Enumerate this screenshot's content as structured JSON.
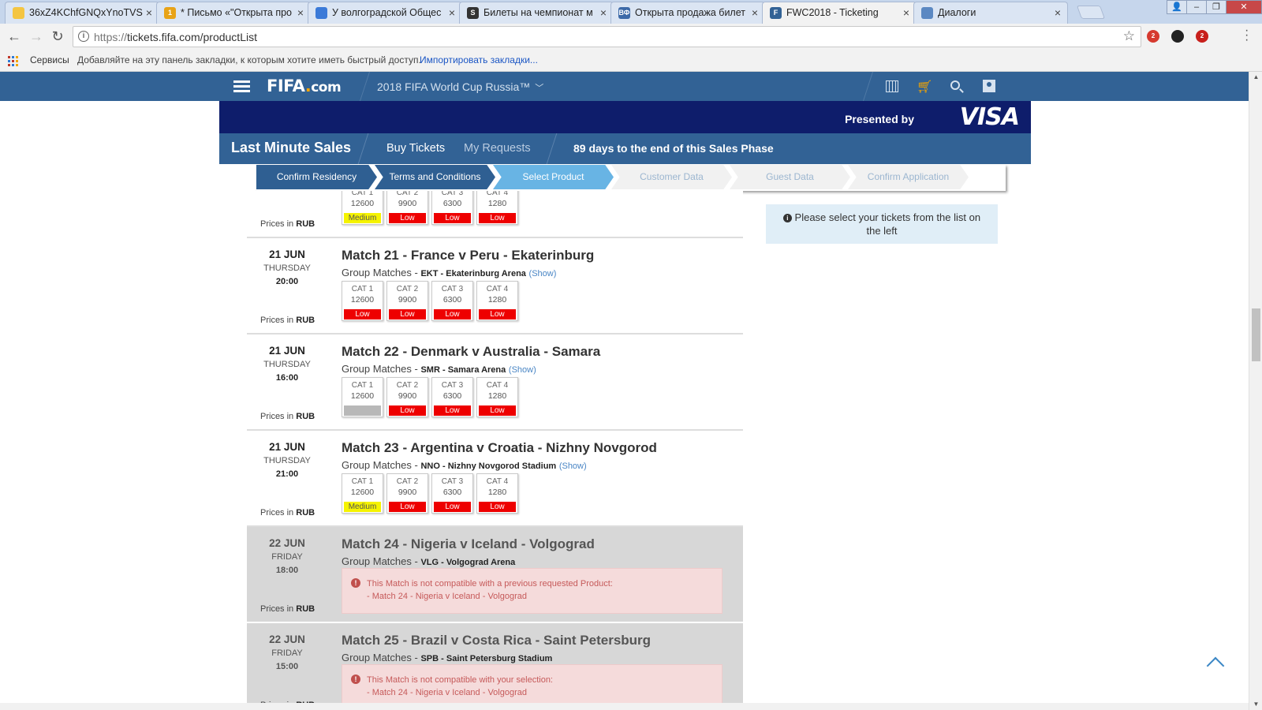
{
  "browser": {
    "tabs": [
      {
        "title": "36xZ4KChfGNQxYnoTVS",
        "favicon_color": "#f4c542",
        "favicon_glyph": "",
        "active": false
      },
      {
        "title": "* Письмо «\"Открыта про",
        "favicon_color": "#e8a317",
        "favicon_glyph": "1",
        "active": false
      },
      {
        "title": "У волгоградской Общес",
        "favicon_color": "#3b7ad8",
        "favicon_glyph": "",
        "active": false
      },
      {
        "title": "Билеты на чемпионат м",
        "favicon_color": "#333333",
        "favicon_glyph": "S",
        "active": false
      },
      {
        "title": "Открыта продажа билет",
        "favicon_color": "#3d6aa8",
        "favicon_glyph": "ВФ",
        "active": false
      },
      {
        "title": "FWC2018 - Ticketing",
        "favicon_color": "#326295",
        "favicon_glyph": "F",
        "active": true
      },
      {
        "title": "Диалоги",
        "favicon_color": "#5b88c2",
        "favicon_glyph": "",
        "active": false
      }
    ],
    "tab_close_glyph": "×",
    "url_prefix": "https://",
    "url_main": "tickets.fifa.com/productList",
    "bookmarks": {
      "services": "Сервисы",
      "hint": "Добавляйте на эту панель закладки, к которым хотите иметь быстрый доступ.",
      "import_link": "Импортировать закладки..."
    },
    "extensions": [
      {
        "name": "opera-ext-icon",
        "color": "#d63a2f",
        "badge": "2"
      },
      {
        "name": "flash-ext-icon",
        "color": "#222222",
        "badge": ""
      },
      {
        "name": "adblock-ext-icon",
        "color": "#c8201c",
        "badge": "2"
      }
    ]
  },
  "site": {
    "logo_text": "FIFA",
    "logo_dot": ".",
    "logo_com": "com",
    "event": "2018 FIFA World Cup Russia™",
    "presented_by": "Presented by",
    "sponsor": "VISA",
    "section_title": "Last Minute Sales",
    "nav_buy": "Buy Tickets",
    "nav_requests": "My Requests",
    "days_left": "89 days to the end of this Sales Phase"
  },
  "steps": [
    {
      "label": "Confirm Residency",
      "state": "done"
    },
    {
      "label": "Terms and Conditions",
      "state": "done"
    },
    {
      "label": "Select Product",
      "state": "current"
    },
    {
      "label": "Customer Data",
      "state": "todo"
    },
    {
      "label": "Guest Data",
      "state": "todo"
    },
    {
      "label": "Confirm Application",
      "state": "todo"
    }
  ],
  "prices_in_label": "Prices in",
  "currency": "RUB",
  "group_label": "Group Matches -",
  "show_label": "(Show)",
  "availability_colors": {
    "Low": "#ee0000",
    "Medium": "#f5f300",
    "None": "#b8b8b8"
  },
  "matches": [
    {
      "partial": true,
      "cats": [
        {
          "name": "CAT 1",
          "price": "12600",
          "availability": "Medium"
        },
        {
          "name": "CAT 2",
          "price": "9900",
          "availability": "Low"
        },
        {
          "name": "CAT 3",
          "price": "6300",
          "availability": "Low"
        },
        {
          "name": "CAT 4",
          "price": "1280",
          "availability": "Low"
        }
      ]
    },
    {
      "day": "21 JUN",
      "weekday": "THURSDAY",
      "time": "20:00",
      "title": "Match 21 - France v Peru - Ekaterinburg",
      "venue_code": "EKT",
      "venue": "Ekaterinburg Arena",
      "cats": [
        {
          "name": "CAT 1",
          "price": "12600",
          "availability": "Low"
        },
        {
          "name": "CAT 2",
          "price": "9900",
          "availability": "Low"
        },
        {
          "name": "CAT 3",
          "price": "6300",
          "availability": "Low"
        },
        {
          "name": "CAT 4",
          "price": "1280",
          "availability": "Low"
        }
      ]
    },
    {
      "day": "21 JUN",
      "weekday": "THURSDAY",
      "time": "16:00",
      "title": "Match 22 - Denmark v Australia - Samara",
      "venue_code": "SMR",
      "venue": "Samara Arena",
      "cats": [
        {
          "name": "CAT 1",
          "price": "12600",
          "availability": ""
        },
        {
          "name": "CAT 2",
          "price": "9900",
          "availability": "Low"
        },
        {
          "name": "CAT 3",
          "price": "6300",
          "availability": "Low"
        },
        {
          "name": "CAT 4",
          "price": "1280",
          "availability": "Low"
        }
      ]
    },
    {
      "day": "21 JUN",
      "weekday": "THURSDAY",
      "time": "21:00",
      "title": "Match 23 - Argentina v Croatia - Nizhny Novgorod",
      "venue_code": "NNO",
      "venue": "Nizhny Novgorod Stadium",
      "cats": [
        {
          "name": "CAT 1",
          "price": "12600",
          "availability": "Medium"
        },
        {
          "name": "CAT 2",
          "price": "9900",
          "availability": "Low"
        },
        {
          "name": "CAT 3",
          "price": "6300",
          "availability": "Low"
        },
        {
          "name": "CAT 4",
          "price": "1280",
          "availability": "Low"
        }
      ]
    },
    {
      "day": "22 JUN",
      "weekday": "FRIDAY",
      "time": "18:00",
      "title": "Match 24 - Nigeria v Iceland - Volgograd",
      "venue_code": "VLG",
      "venue": "Volgograd Arena",
      "disabled": true,
      "alert_line1": "This Match is not compatible with a previous requested Product:",
      "alert_line2": "- Match 24 - Nigeria v Iceland - Volgograd"
    },
    {
      "day": "22 JUN",
      "weekday": "FRIDAY",
      "time": "15:00",
      "title": "Match 25 - Brazil v Costa Rica - Saint Petersburg",
      "venue_code": "SPB",
      "venue": "Saint Petersburg Stadium",
      "disabled": true,
      "alert_line1": "This Match is not compatible with your selection:",
      "alert_line2": "- Match 24 - Nigeria v Iceland - Volgograd"
    }
  ],
  "info_message": "Please select your tickets from the list on the left"
}
